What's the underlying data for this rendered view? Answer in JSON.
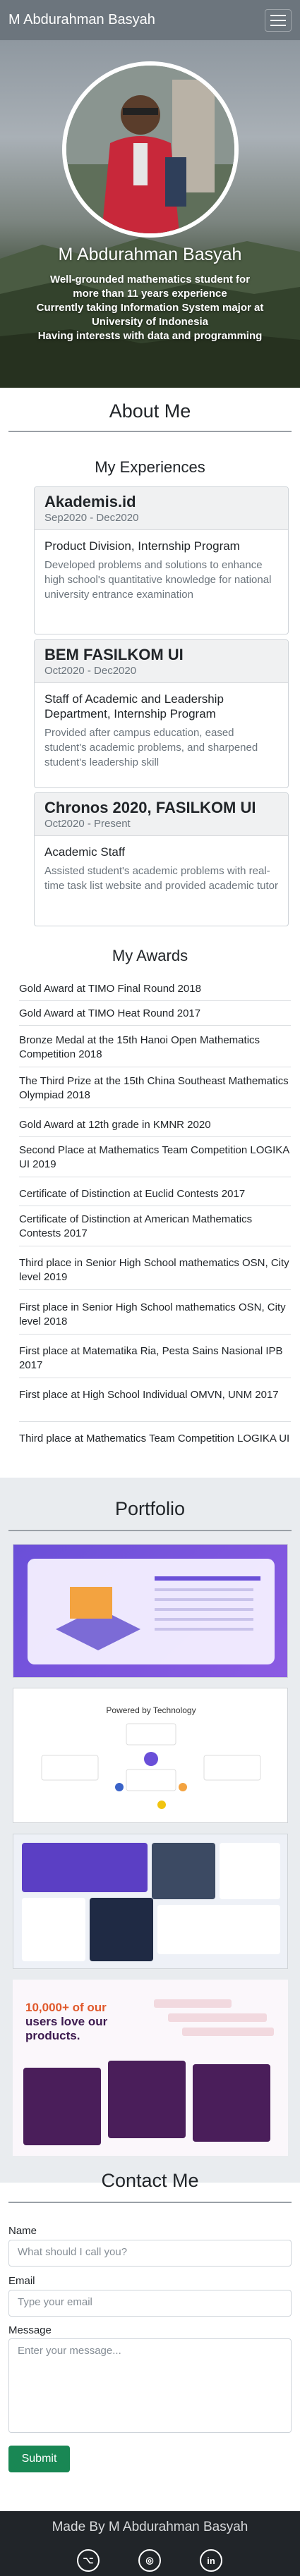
{
  "navbar": {
    "brand": "M Abdurahman Basyah",
    "menu_icon": "hamburger-icon"
  },
  "hero": {
    "name": "M Abdurahman Basyah",
    "description_lines": [
      "Well-grounded mathematics student for",
      "more than 11 years experience",
      "Currently taking Information System major at",
      "University of Indonesia",
      "Having interests with data and programming"
    ]
  },
  "about": {
    "title": "About Me"
  },
  "experiences": {
    "title": "My Experiences",
    "items": [
      {
        "org": "Akademis.id",
        "date": "Sep2020 - Dec2020",
        "role": "Product Division, Internship Program",
        "desc": "Developed problems and solutions to enhance high school's quantitative knowledge for national university entrance examination"
      },
      {
        "org": "BEM FASILKOM UI",
        "date": "Oct2020 - Dec2020",
        "role": "Staff of Academic and Leadership Department, Internship Program",
        "desc": "Provided after campus education, eased student's academic problems, and sharpened student's leadership skill"
      },
      {
        "org": "Chronos 2020, FASILKOM UI",
        "date": "Oct2020 - Present",
        "role": "Academic Staff",
        "desc": "Assisted student's academic problems with real-time task list website and provided academic tutor"
      }
    ]
  },
  "awards": {
    "title": "My Awards",
    "items": [
      "Gold Award at TIMO Final Round 2018",
      "Gold Award at TIMO Heat Round 2017",
      "Bronze Medal at the 15th Hanoi Open Mathematics Competition 2018",
      "The Third Prize at the 15th China Southeast Mathematics Olympiad 2018",
      "Gold Award at 12th grade in KMNR 2020",
      "Second Place at Mathematics Team Competition LOGIKA UI 2019",
      "Certificate of Distinction at Euclid Contests 2017",
      "Certificate of Distinction at American Mathematics Contests 2017",
      "Third place in Senior High School mathematics OSN, City level 2019",
      "First place in Senior High School mathematics OSN, City level 2018",
      "First place at Matematika Ria, Pesta Sains Nasional IPB 2017",
      "First place at High School Individual OMVN, UNM 2017",
      "Third place at Mathematics Team Competition LOGIKA UI"
    ]
  },
  "portfolio": {
    "title": "Portfolio",
    "shot2": {
      "heading": "Powered by Technology"
    },
    "shot4": {
      "heading_line1": "10,000+ of our",
      "heading_line2": "users love our",
      "heading_line3": "products."
    }
  },
  "contact": {
    "title": "Contact Me",
    "name_label": "Name",
    "name_placeholder": "What should I call you?",
    "email_label": "Email",
    "email_placeholder": "Type your email",
    "message_label": "Message",
    "message_placeholder": "Enter your message...",
    "submit_label": "Submit"
  },
  "footer": {
    "made_by": "Made By M Abdurahman Basyah",
    "social": [
      {
        "icon": "github-icon",
        "glyph": "⌥"
      },
      {
        "icon": "instagram-icon",
        "glyph": "◎"
      },
      {
        "icon": "linkedin-icon",
        "glyph": "in"
      }
    ]
  },
  "colors": {
    "navbar": "#6c757d",
    "submit": "#198754",
    "footer": "#212529",
    "portfolio_bg": "#e9ecef"
  }
}
